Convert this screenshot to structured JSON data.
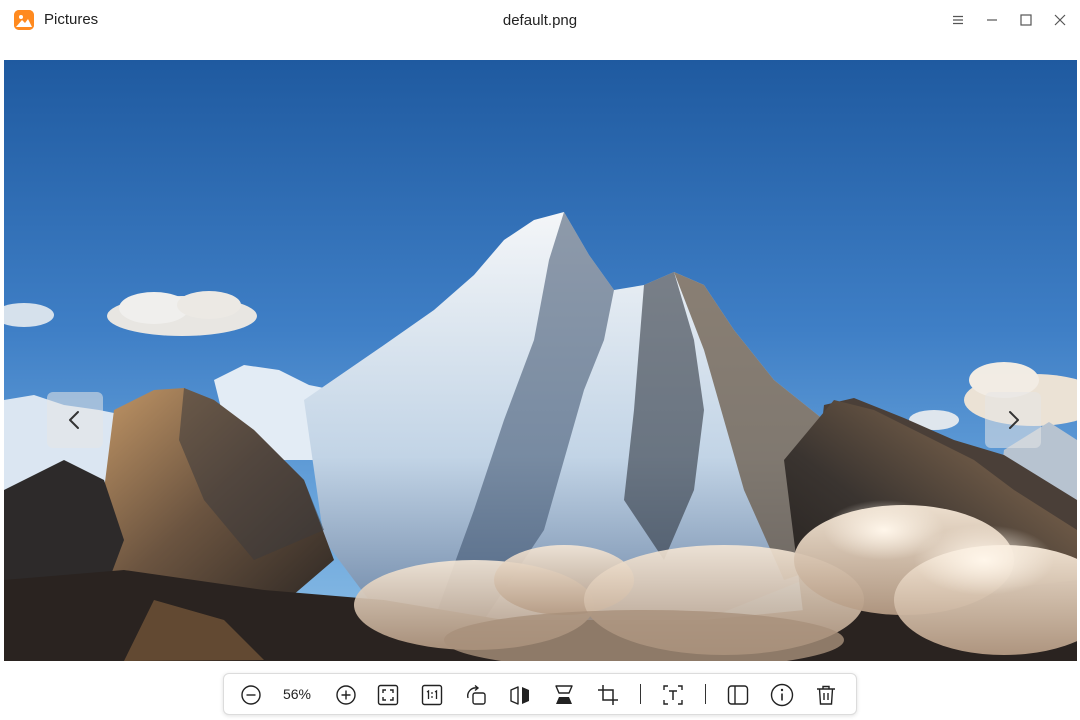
{
  "app": {
    "name": "Pictures",
    "icon": "pictures-app-icon",
    "accent_color": "#ff8a1f"
  },
  "window": {
    "title": "default.png",
    "controls": [
      "menu-icon",
      "minimize-icon",
      "maximize-icon",
      "close-icon"
    ]
  },
  "viewer": {
    "image": "snow-capped mountain peak under blue sky with clouds",
    "prev_icon": "chevron-left-icon",
    "next_icon": "chevron-right-icon"
  },
  "toolbar": {
    "zoom_level": "56%",
    "buttons": [
      "zoom-out-icon",
      "zoom-in-icon",
      "fit-to-window-icon",
      "actual-size-icon",
      "rotate-icon",
      "flip-horizontal-icon",
      "flip-vertical-icon",
      "crop-icon",
      "extract-text-icon",
      "thumbnail-panel-icon",
      "info-icon",
      "delete-icon"
    ]
  }
}
